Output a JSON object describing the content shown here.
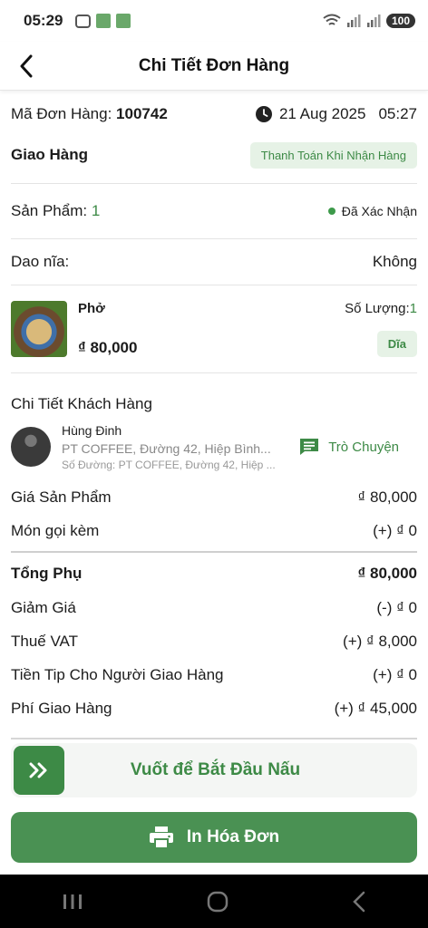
{
  "status_bar": {
    "time": "05:29",
    "battery": "100"
  },
  "header": {
    "title": "Chi Tiết Đơn Hàng"
  },
  "order": {
    "id_label": "Mã Đơn Hàng:",
    "id_value": "100742",
    "date": "21 Aug 2025",
    "time": "05:27",
    "delivery_type": "Giao Hàng",
    "payment_method": "Thanh Toán Khi Nhận Hàng",
    "products_label": "Sản Phẩm:",
    "products_count": "1",
    "status": "Đã Xác Nhận",
    "utensils_label": "Dao nĩa:",
    "utensils_value": "Không"
  },
  "item": {
    "name": "Phở",
    "price": "₫ 80,000",
    "quantity_label": "Số Lượng:",
    "quantity_value": "1",
    "unit": "Dĩa"
  },
  "customer": {
    "section_title": "Chi Tiết Khách Hàng",
    "name": "Hùng Đinh",
    "address": "PT COFFEE, Đường 42, Hiệp Bình...",
    "street": "Số Đường: PT COFFEE, Đường 42, Hiệp ...",
    "chat_label": "Trò Chuyện"
  },
  "summary": {
    "rows_top": [
      {
        "label": "Giá Sản Phẩm",
        "value": "₫ 80,000"
      },
      {
        "label": "Món gọi kèm",
        "value": "(+) ₫ 0"
      }
    ],
    "subtotal": {
      "label": "Tổng Phụ",
      "value": "₫ 80,000"
    },
    "rows_bottom": [
      {
        "label": "Giảm Giá",
        "value": "(-) ₫ 0"
      },
      {
        "label": "Thuế VAT",
        "value": "(+) ₫ 8,000"
      },
      {
        "label": "Tiền Tip Cho Người Giao Hàng",
        "value": "(+) ₫ 0"
      },
      {
        "label": "Phí Giao Hàng",
        "value": "(+) ₫ 45,000"
      }
    ]
  },
  "actions": {
    "slide_label": "Vuốt để Bắt Đầu Nấu",
    "print_label": "In Hóa Đơn"
  },
  "colors": {
    "accent": "#3d8a46",
    "pill_bg": "#e6f2e6"
  }
}
